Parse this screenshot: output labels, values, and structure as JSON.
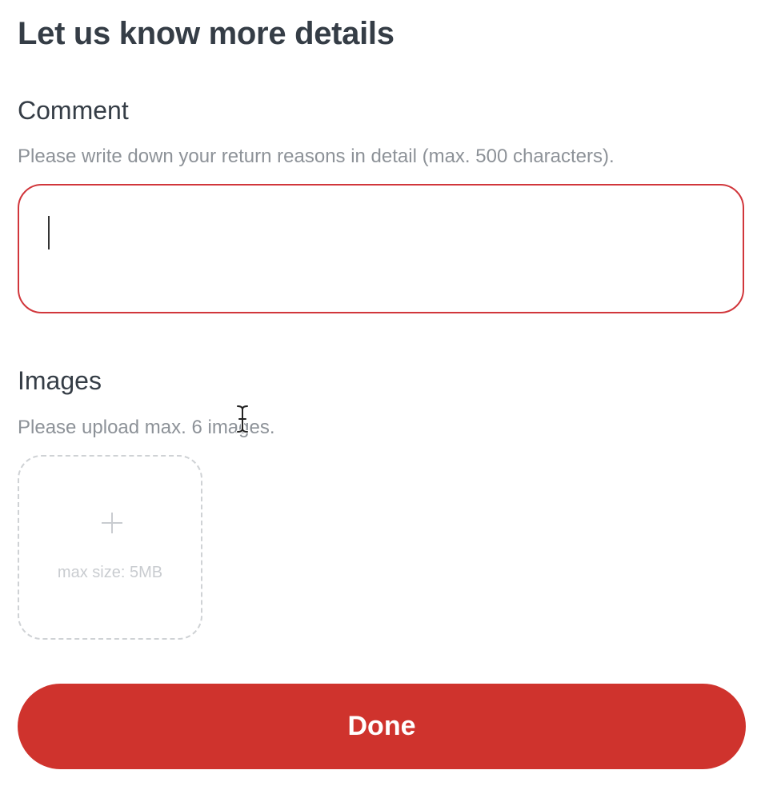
{
  "header": {
    "title": "Let us know more details"
  },
  "comment": {
    "label": "Comment",
    "hint": "Please write down your return reasons in detail (max. 500 characters).",
    "value": "",
    "accent_color": "#d1363b"
  },
  "images": {
    "label": "Images",
    "hint": "Please upload max. 6 images.",
    "upload_tile": {
      "icon": "plus-icon",
      "max_size_text": "max size: 5MB"
    }
  },
  "footer": {
    "done_label": "Done",
    "button_color": "#cf332d"
  },
  "cursor": {
    "icon": "text-cursor-icon"
  }
}
